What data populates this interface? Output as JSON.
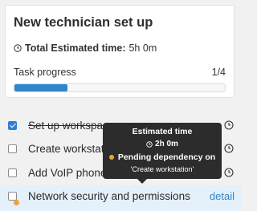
{
  "checklist": {
    "title": "New technician set up",
    "estimate_label": "Total Estimated time:",
    "estimate_value": "5h 0m",
    "progress_label": "Task progress",
    "progress_count": "1/4",
    "progress_fraction": 0.25
  },
  "tasks": [
    {
      "label": "Set up workspace",
      "done": true
    },
    {
      "label": "Create workstation",
      "done": false
    },
    {
      "label": "Add VoIP phone",
      "done": false
    },
    {
      "label": "Network security and permissions",
      "done": false,
      "action": "detail"
    }
  ],
  "tooltip": {
    "title": "Estimated time",
    "time": "2h 0m",
    "dependency": "Pending dependency on",
    "dependency_task": "'Create workstation'"
  },
  "colors": {
    "accent": "#2f86c9",
    "pending": "#f0a23a"
  }
}
